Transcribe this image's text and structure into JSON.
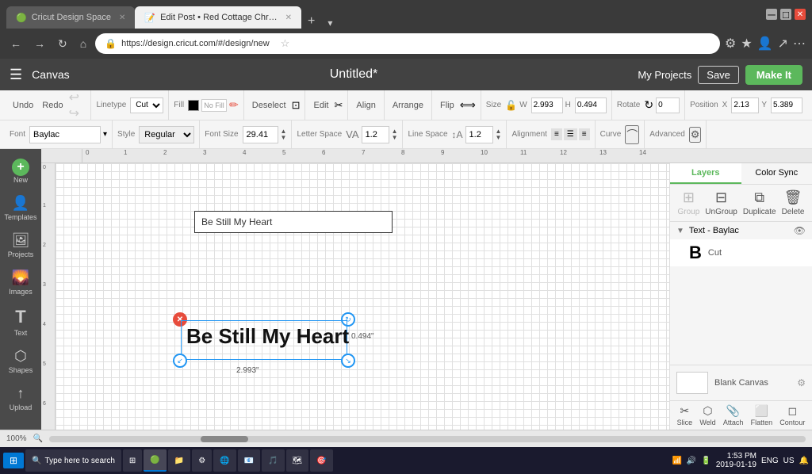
{
  "browser": {
    "tabs": [
      {
        "label": "Cricut Design Space",
        "active": false,
        "icon": "🟢"
      },
      {
        "label": "Edit Post • Red Cottage Chr…",
        "active": true,
        "icon": "📝"
      }
    ],
    "new_tab": "+",
    "url": "https://design.cricut.com/#/design/new",
    "nav": {
      "back": "←",
      "forward": "→",
      "refresh": "↻",
      "home": "⌂"
    }
  },
  "app": {
    "title": "Untitled*",
    "header": {
      "menu_icon": "☰",
      "canvas_label": "Canvas",
      "my_projects_label": "My Projects",
      "save_label": "Save",
      "make_it_label": "Make It"
    }
  },
  "toolbar": {
    "undo_label": "Undo",
    "redo_label": "Redo",
    "linetype_label": "Linetype",
    "linetype_value": "Cut",
    "fill_label": "Fill",
    "fill_value": "No Fill",
    "deselect_label": "Deselect",
    "edit_label": "Edit",
    "align_label": "Align",
    "arrange_label": "Arrange",
    "flip_label": "Flip",
    "size_label": "Size",
    "width_label": "W",
    "width_value": "2.993",
    "height_label": "H",
    "height_value": "0.494",
    "rotate_label": "Rotate",
    "rotate_value": "0",
    "position_label": "Position",
    "x_label": "X",
    "x_value": "2.13",
    "y_label": "Y",
    "y_value": "5.389"
  },
  "font_toolbar": {
    "font_label": "Font",
    "font_value": "Baylac",
    "style_label": "Style",
    "style_value": "Regular",
    "font_size_label": "Font Size",
    "font_size_value": "29.41",
    "letter_space_label": "Letter Space",
    "letter_space_value": "1.2",
    "line_space_label": "Line Space",
    "line_space_value": "1.2",
    "alignment_label": "Alignment",
    "curve_label": "Curve",
    "advanced_label": "Advanced"
  },
  "sidebar": {
    "items": [
      {
        "icon": "+",
        "label": "New"
      },
      {
        "icon": "👤",
        "label": "Templates"
      },
      {
        "icon": "🖼",
        "label": "Projects"
      },
      {
        "icon": "🌄",
        "label": "Images"
      },
      {
        "icon": "T",
        "label": "Text"
      },
      {
        "icon": "⬡",
        "label": "Shapes"
      },
      {
        "icon": "↑",
        "label": "Upload"
      }
    ]
  },
  "canvas": {
    "text_content": "Be Still My Heart",
    "text_input_value": "Be Still My Heart",
    "width_dim": "2.993\"",
    "height_dim": "0.494\"",
    "zoom": "100%",
    "ruler_numbers": [
      "0",
      "1",
      "2",
      "3",
      "4",
      "5",
      "6",
      "7",
      "8",
      "9",
      "10",
      "11",
      "12",
      "13",
      "14"
    ]
  },
  "right_panel": {
    "tabs": [
      {
        "label": "Layers",
        "active": true
      },
      {
        "label": "Color Sync",
        "active": false
      }
    ],
    "actions": [
      {
        "label": "Group",
        "icon": "⊞",
        "disabled": true
      },
      {
        "label": "UnGroup",
        "icon": "⊟",
        "disabled": false
      },
      {
        "label": "Duplicate",
        "icon": "⧉",
        "disabled": false
      },
      {
        "label": "Delete",
        "icon": "🗑",
        "disabled": false
      }
    ],
    "layer": {
      "name": "Text - Baylac",
      "subitem": {
        "letter": "B",
        "cut_label": "Cut"
      }
    },
    "canvas_preview": {
      "label": "Blank Canvas"
    },
    "bottom_actions": [
      {
        "label": "Slice",
        "icon": "✂"
      },
      {
        "label": "Weld",
        "icon": "⬡"
      },
      {
        "label": "Attach",
        "icon": "📎"
      },
      {
        "label": "Flatten",
        "icon": "⬜"
      },
      {
        "label": "Contour",
        "icon": "◻"
      }
    ]
  },
  "taskbar": {
    "search_placeholder": "Type here to search",
    "items": [
      {
        "label": "⊞",
        "active": false
      },
      {
        "label": "🔔",
        "active": false
      },
      {
        "label": "📁",
        "active": false
      },
      {
        "label": "⚙",
        "active": false
      },
      {
        "label": "🌐",
        "active": false
      },
      {
        "label": "📧",
        "active": false
      },
      {
        "label": "🎵",
        "active": false
      }
    ],
    "time": "1:53 PM",
    "date": "2019-01-19",
    "language": "ENG",
    "region": "US"
  },
  "colors": {
    "app_header": "#424242",
    "sidebar_bg": "#4a4a4a",
    "make_it_green": "#5cb85c",
    "selection_blue": "#2196F3",
    "handle_red": "#e74c3c",
    "taskbar_bg": "#1a1a2e",
    "taskbar_active": "#0078d4"
  }
}
